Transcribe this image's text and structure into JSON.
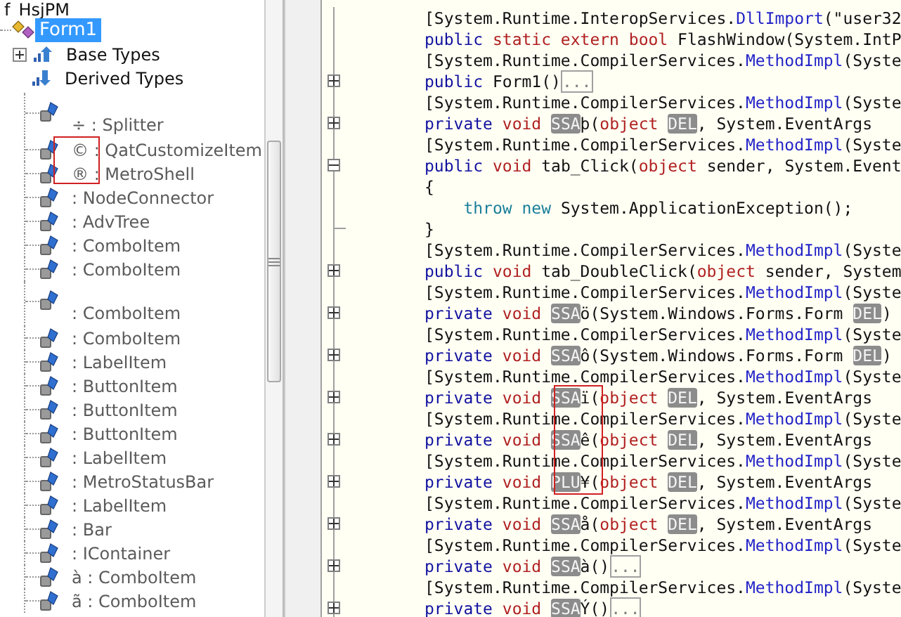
{
  "tree": {
    "root": {
      "label": "HsjPM",
      "prefix": "f",
      "expanded": true
    },
    "class": {
      "label": "Form1",
      "selected": true
    },
    "groups": [
      {
        "label": "Base Types",
        "kind": "base",
        "expanded": false
      },
      {
        "label": "Derived Types",
        "kind": "derived"
      }
    ],
    "members": [
      {
        "label": "÷ : Splitter",
        "kind": "tall"
      },
      {
        "label": "© : QatCustomizeItem",
        "kind": "row"
      },
      {
        "label": "® : MetroShell",
        "kind": "row"
      },
      {
        "label": ": NodeConnector",
        "kind": "row"
      },
      {
        "label": ": AdvTree",
        "kind": "row"
      },
      {
        "label": ": ComboItem",
        "kind": "row"
      },
      {
        "label": ": ComboItem",
        "kind": "row"
      },
      {
        "label": ": ComboItem",
        "kind": "tall"
      },
      {
        "label": ": ComboItem",
        "kind": "row"
      },
      {
        "label": ": LabelItem",
        "kind": "row"
      },
      {
        "label": ": ButtonItem",
        "kind": "row"
      },
      {
        "label": ": ButtonItem",
        "kind": "row"
      },
      {
        "label": ": ButtonItem",
        "kind": "row"
      },
      {
        "label": ": LabelItem",
        "kind": "row"
      },
      {
        "label": ": MetroStatusBar",
        "kind": "row"
      },
      {
        "label": ": LabelItem",
        "kind": "row"
      },
      {
        "label": ": Bar",
        "kind": "row"
      },
      {
        "label": ": IContainer",
        "kind": "row"
      },
      {
        "label": "à : ComboItem",
        "kind": "row"
      },
      {
        "label": "ã : ComboItem",
        "kind": "row"
      }
    ]
  },
  "code": {
    "lines": [
      {
        "tokens": [
          {
            "kind": "text",
            "text": "[System.Runtime.InteropServices."
          },
          {
            "kind": "attr",
            "text": "DllImport"
          },
          {
            "kind": "text",
            "text": "(\"user32"
          }
        ]
      },
      {
        "tokens": [
          {
            "kind": "kw",
            "text": "public "
          },
          {
            "kind": "type",
            "text": "static extern bool "
          },
          {
            "kind": "text",
            "text": "FlashWindow(System.IntP"
          }
        ]
      },
      {
        "tokens": [
          {
            "kind": "text",
            "text": "[System.Runtime.CompilerServices."
          },
          {
            "kind": "attr",
            "text": "MethodImpl"
          },
          {
            "kind": "text",
            "text": "(Syste"
          }
        ]
      },
      {
        "expanded": false,
        "tokens": [
          {
            "kind": "kw",
            "text": "public "
          },
          {
            "kind": "text",
            "text": "Form1()"
          },
          {
            "kind": "folded",
            "text": "..."
          }
        ]
      },
      {
        "tokens": [
          {
            "kind": "text",
            "text": "[System.Runtime.CompilerServices."
          },
          {
            "kind": "attr",
            "text": "MethodImpl"
          },
          {
            "kind": "text",
            "text": "(Syste"
          }
        ]
      },
      {
        "expanded": false,
        "tokens": [
          {
            "kind": "kw",
            "text": "private "
          },
          {
            "kind": "type",
            "text": "void "
          },
          {
            "kind": "masked",
            "text": "SSA"
          },
          {
            "kind": "text",
            "text": "þ("
          },
          {
            "kind": "type",
            "text": "object "
          },
          {
            "kind": "masked",
            "text": "DEL"
          },
          {
            "kind": "text",
            "text": ", System.EventArgs"
          }
        ]
      },
      {
        "tokens": [
          {
            "kind": "text",
            "text": "[System.Runtime.CompilerServices."
          },
          {
            "kind": "attr",
            "text": "MethodImpl"
          },
          {
            "kind": "text",
            "text": "(Syste"
          }
        ]
      },
      {
        "expanded": true,
        "tokens": [
          {
            "kind": "kw",
            "text": "public "
          },
          {
            "kind": "type",
            "text": "void "
          },
          {
            "kind": "text",
            "text": "tab_Click("
          },
          {
            "kind": "type",
            "text": "object "
          },
          {
            "kind": "text",
            "text": "sender, System.Event"
          }
        ]
      },
      {
        "tokens": [
          {
            "kind": "text",
            "text": "{"
          }
        ]
      },
      {
        "tokens": [
          {
            "kind": "flow",
            "text": "    throw new "
          },
          {
            "kind": "text",
            "text": "System.ApplicationException();"
          }
        ]
      },
      {
        "block_end": true,
        "tokens": [
          {
            "kind": "text",
            "text": "}"
          }
        ]
      },
      {
        "tokens": [
          {
            "kind": "text",
            "text": "[System.Runtime.CompilerServices."
          },
          {
            "kind": "attr",
            "text": "MethodImpl"
          },
          {
            "kind": "text",
            "text": "(Syste"
          }
        ]
      },
      {
        "expanded": false,
        "tokens": [
          {
            "kind": "kw",
            "text": "public "
          },
          {
            "kind": "type",
            "text": "void "
          },
          {
            "kind": "text",
            "text": "tab_DoubleClick("
          },
          {
            "kind": "type",
            "text": "object "
          },
          {
            "kind": "text",
            "text": "sender, System"
          }
        ]
      },
      {
        "tokens": [
          {
            "kind": "text",
            "text": "[System.Runtime.CompilerServices."
          },
          {
            "kind": "attr",
            "text": "MethodImpl"
          },
          {
            "kind": "text",
            "text": "(Syste"
          }
        ]
      },
      {
        "expanded": false,
        "tokens": [
          {
            "kind": "kw",
            "text": "private "
          },
          {
            "kind": "type",
            "text": "void "
          },
          {
            "kind": "masked",
            "text": "SSA"
          },
          {
            "kind": "text",
            "text": "ö(System.Windows.Forms.Form "
          },
          {
            "kind": "masked",
            "text": "DEL"
          },
          {
            "kind": "text",
            "text": ")"
          }
        ]
      },
      {
        "tokens": [
          {
            "kind": "text",
            "text": "[System.Runtime.CompilerServices."
          },
          {
            "kind": "attr",
            "text": "MethodImpl"
          },
          {
            "kind": "text",
            "text": "(Syste"
          }
        ]
      },
      {
        "expanded": false,
        "tokens": [
          {
            "kind": "kw",
            "text": "private "
          },
          {
            "kind": "type",
            "text": "void "
          },
          {
            "kind": "masked",
            "text": "SSA"
          },
          {
            "kind": "text",
            "text": "ô(System.Windows.Forms.Form "
          },
          {
            "kind": "masked",
            "text": "DEL"
          },
          {
            "kind": "text",
            "text": ")"
          }
        ]
      },
      {
        "tokens": [
          {
            "kind": "text",
            "text": "[System.Runtime.CompilerServices."
          },
          {
            "kind": "attr",
            "text": "MethodImpl"
          },
          {
            "kind": "text",
            "text": "(Syste"
          }
        ]
      },
      {
        "expanded": false,
        "tokens": [
          {
            "kind": "kw",
            "text": "private "
          },
          {
            "kind": "type",
            "text": "void "
          },
          {
            "kind": "masked",
            "text": "SSA"
          },
          {
            "kind": "text",
            "text": "ï("
          },
          {
            "kind": "type",
            "text": "object "
          },
          {
            "kind": "masked",
            "text": "DEL"
          },
          {
            "kind": "text",
            "text": ", System.EventArgs"
          }
        ]
      },
      {
        "tokens": [
          {
            "kind": "text",
            "text": "[System.Runtime.CompilerServices."
          },
          {
            "kind": "attr",
            "text": "MethodImpl"
          },
          {
            "kind": "text",
            "text": "(Syste"
          }
        ]
      },
      {
        "expanded": false,
        "tokens": [
          {
            "kind": "kw",
            "text": "private "
          },
          {
            "kind": "type",
            "text": "void "
          },
          {
            "kind": "masked",
            "text": "SSA"
          },
          {
            "kind": "text",
            "text": "ê("
          },
          {
            "kind": "type",
            "text": "object "
          },
          {
            "kind": "masked",
            "text": "DEL"
          },
          {
            "kind": "text",
            "text": ", System.EventArgs"
          }
        ]
      },
      {
        "tokens": [
          {
            "kind": "text",
            "text": "[System.Runtime.CompilerServices."
          },
          {
            "kind": "attr",
            "text": "MethodImpl"
          },
          {
            "kind": "text",
            "text": "(Syste"
          }
        ]
      },
      {
        "expanded": false,
        "tokens": [
          {
            "kind": "kw",
            "text": "private "
          },
          {
            "kind": "type",
            "text": "void "
          },
          {
            "kind": "masked",
            "text": "PLU"
          },
          {
            "kind": "text",
            "text": "¥("
          },
          {
            "kind": "type",
            "text": "object "
          },
          {
            "kind": "masked",
            "text": "DEL"
          },
          {
            "kind": "text",
            "text": ", System.EventArgs"
          }
        ]
      },
      {
        "tokens": [
          {
            "kind": "text",
            "text": "[System.Runtime.CompilerServices."
          },
          {
            "kind": "attr",
            "text": "MethodImpl"
          },
          {
            "kind": "text",
            "text": "(Syste"
          }
        ]
      },
      {
        "expanded": false,
        "tokens": [
          {
            "kind": "kw",
            "text": "private "
          },
          {
            "kind": "type",
            "text": "void "
          },
          {
            "kind": "masked",
            "text": "SSA"
          },
          {
            "kind": "text",
            "text": "å("
          },
          {
            "kind": "type",
            "text": "object "
          },
          {
            "kind": "masked",
            "text": "DEL"
          },
          {
            "kind": "text",
            "text": ", System.EventArgs"
          }
        ]
      },
      {
        "tokens": [
          {
            "kind": "text",
            "text": "[System.Runtime.CompilerServices."
          },
          {
            "kind": "attr",
            "text": "MethodImpl"
          },
          {
            "kind": "text",
            "text": "(Syste"
          }
        ]
      },
      {
        "expanded": false,
        "tokens": [
          {
            "kind": "kw",
            "text": "private "
          },
          {
            "kind": "type",
            "text": "void "
          },
          {
            "kind": "masked",
            "text": "SSA"
          },
          {
            "kind": "text",
            "text": "à()"
          },
          {
            "kind": "folded",
            "text": "..."
          }
        ]
      },
      {
        "tokens": [
          {
            "kind": "text",
            "text": "[System.Runtime.CompilerServices."
          },
          {
            "kind": "attr",
            "text": "MethodImpl"
          },
          {
            "kind": "text",
            "text": "(Syste"
          }
        ]
      },
      {
        "expanded": false,
        "tokens": [
          {
            "kind": "kw",
            "text": "private "
          },
          {
            "kind": "type",
            "text": "void "
          },
          {
            "kind": "masked",
            "text": "SSA"
          },
          {
            "kind": "text",
            "text": "Ý()"
          },
          {
            "kind": "folded",
            "text": "..."
          }
        ]
      }
    ]
  }
}
